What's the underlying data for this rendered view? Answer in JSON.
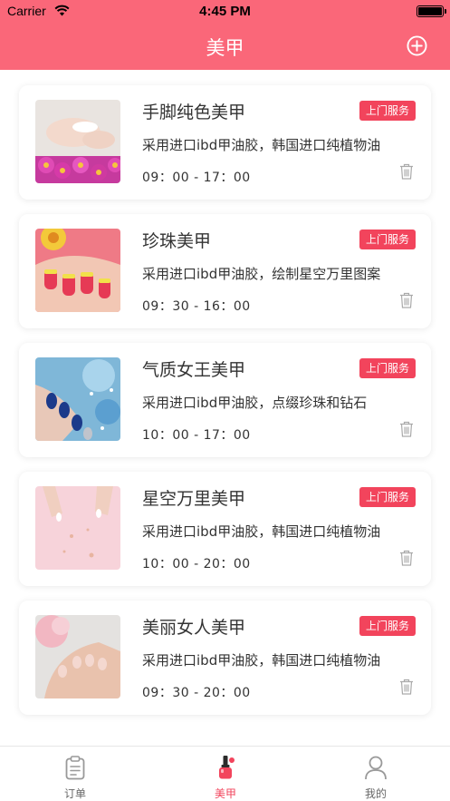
{
  "status_bar": {
    "carrier": "Carrier",
    "time": "4:45 PM"
  },
  "nav": {
    "title": "美甲",
    "add_icon": "plus-circle-icon"
  },
  "colors": {
    "brand": "#fa6779",
    "badge": "#f2445c",
    "active_tab": "#f2445c"
  },
  "services": [
    {
      "name": "手脚纯色美甲",
      "badge": "上门服务",
      "description": "采用进口ibd甲油胶，韩国进口纯植物油",
      "hours": "09：00 - 17：00"
    },
    {
      "name": "珍珠美甲",
      "badge": "上门服务",
      "description": "采用进口ibd甲油胶，绘制星空万里图案",
      "hours": "09：30 - 16：00"
    },
    {
      "name": "气质女王美甲",
      "badge": "上门服务",
      "description": "采用进口ibd甲油胶，点缀珍珠和钻石",
      "hours": "10：00 - 17：00"
    },
    {
      "name": "星空万里美甲",
      "badge": "上门服务",
      "description": "采用进口ibd甲油胶，韩国进口纯植物油",
      "hours": "10：00 - 20：00"
    },
    {
      "name": "美丽女人美甲",
      "badge": "上门服务",
      "description": "采用进口ibd甲油胶，韩国进口纯植物油",
      "hours": "09：30 - 20：00"
    }
  ],
  "tabs": [
    {
      "label": "订单",
      "icon": "clipboard-icon",
      "active": false
    },
    {
      "label": "美甲",
      "icon": "nail-polish-icon",
      "active": true
    },
    {
      "label": "我的",
      "icon": "user-icon",
      "active": false
    }
  ]
}
